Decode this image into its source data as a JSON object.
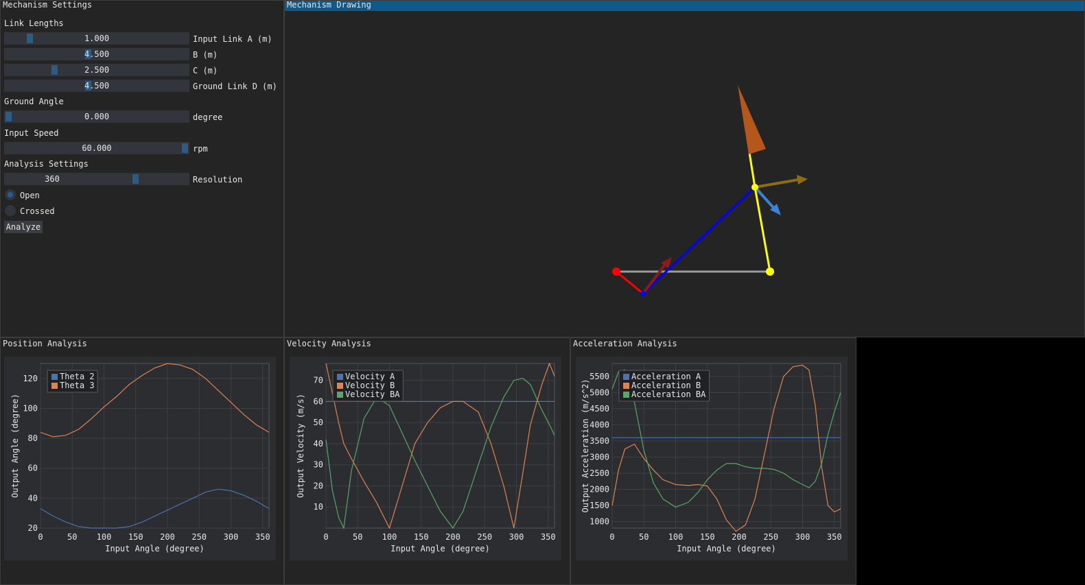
{
  "settings": {
    "title": "Mechanism Settings",
    "link_lengths_header": "Link Lengths",
    "sliders": [
      {
        "value": "1.000",
        "label": "Input Link A (m)",
        "fraction": 0.12
      },
      {
        "value": "4.500",
        "label": "B (m)",
        "fraction": 0.45
      },
      {
        "value": "2.500",
        "label": "C (m)",
        "fraction": 0.26
      },
      {
        "value": "4.500",
        "label": "Ground Link D (m)",
        "fraction": 0.45
      }
    ],
    "ground_angle_header": "Ground Angle",
    "ground_angle": {
      "value": "0.000",
      "label": "degree",
      "fraction": 0.0
    },
    "input_speed_header": "Input Speed",
    "input_speed": {
      "value": "60.000",
      "label": "rpm",
      "fraction": 1.0
    },
    "analysis_header": "Analysis Settings",
    "resolution": {
      "value": "360",
      "label": "Resolution",
      "fraction": 0.72
    },
    "radios": [
      {
        "label": "Open",
        "selected": true
      },
      {
        "label": "Crossed",
        "selected": false
      }
    ],
    "analyze_label": "Analyze",
    "accent_color": "#2a5c86"
  },
  "drawing": {
    "title": "Mechanism Drawing",
    "title_color": "#0f5a8a",
    "link_colors": {
      "input": "#ff0000",
      "coupler": "#0000ff",
      "output": "#ffff00",
      "ground": "#9b9b9b"
    }
  },
  "plots": {
    "position": {
      "title": "Position Analysis",
      "ylabel": "Output Angle (degree)",
      "xlabel": "Input Angle (degree)",
      "legend": [
        "Theta 2",
        "Theta 3"
      ]
    },
    "velocity": {
      "title": "Velocity Analysis",
      "ylabel": "Output Velocity (m/s)",
      "xlabel": "Input Angle (degree)",
      "legend": [
        "Velocity A",
        "Velocity B",
        "Velocity BA"
      ]
    },
    "acceleration": {
      "title": "Acceleration Analysis",
      "ylabel": "Output Acceleration (m/s^2)",
      "xlabel": "Input Angle (degree)",
      "legend": [
        "Acceleration A",
        "Acceleration B",
        "Acceleration BA"
      ]
    }
  },
  "chart_data": [
    {
      "type": "line",
      "xlim": [
        0,
        360
      ],
      "ylim": [
        20,
        130
      ],
      "xticks": [
        0,
        50,
        100,
        150,
        200,
        250,
        300,
        350
      ],
      "yticks": [
        20,
        40,
        60,
        80,
        100,
        120
      ],
      "grid": true,
      "legend_position": "top-left",
      "x": [
        0,
        20,
        40,
        60,
        80,
        100,
        120,
        140,
        160,
        180,
        200,
        220,
        240,
        260,
        280,
        300,
        320,
        340,
        360
      ],
      "series": [
        {
          "name": "Theta 2",
          "color": "#4c72b0",
          "values": [
            33,
            28,
            24,
            21,
            20,
            20,
            20,
            21,
            24,
            28,
            32,
            36,
            40,
            44,
            46,
            45,
            42,
            38,
            33
          ]
        },
        {
          "name": "Theta 3",
          "color": "#dd8452",
          "values": [
            84,
            81,
            82,
            86,
            93,
            101,
            108,
            116,
            122,
            127,
            130,
            129,
            126,
            120,
            112,
            104,
            96,
            89,
            84
          ]
        }
      ]
    },
    {
      "type": "line",
      "xlim": [
        0,
        360
      ],
      "ylim": [
        0,
        78
      ],
      "xticks": [
        0,
        50,
        100,
        150,
        200,
        250,
        300,
        350
      ],
      "yticks": [
        10,
        20,
        30,
        40,
        50,
        60,
        70
      ],
      "grid": true,
      "legend_position": "top-left",
      "x": [
        0,
        10,
        20,
        28,
        40,
        60,
        80,
        100,
        120,
        140,
        160,
        180,
        200,
        216,
        240,
        260,
        280,
        296,
        310,
        322,
        340,
        352,
        360
      ],
      "series": [
        {
          "name": "Velocity A",
          "color": "#4c72b0",
          "values": [
            60,
            60,
            60,
            60,
            60,
            60,
            60,
            60,
            60,
            60,
            60,
            60,
            60,
            60,
            60,
            60,
            60,
            60,
            60,
            60,
            60,
            60,
            60
          ]
        },
        {
          "name": "Velocity B",
          "color": "#dd8452",
          "values": [
            78,
            64,
            50,
            40,
            33,
            22,
            12,
            0,
            20,
            40,
            50,
            57,
            60,
            60,
            55,
            40,
            20,
            0,
            26,
            49,
            68,
            78,
            72
          ]
        },
        {
          "name": "Velocity BA",
          "color": "#55a868",
          "values": [
            42,
            18,
            5,
            0,
            27,
            52,
            62,
            58,
            45,
            32,
            20,
            8,
            0,
            8,
            30,
            48,
            62,
            70,
            71,
            68,
            56,
            49,
            44
          ]
        }
      ]
    },
    {
      "type": "line",
      "xlim": [
        0,
        360
      ],
      "ylim": [
        800,
        5900
      ],
      "xticks": [
        0,
        50,
        100,
        150,
        200,
        250,
        300,
        350
      ],
      "yticks": [
        1000,
        1500,
        2000,
        2500,
        3000,
        3500,
        4000,
        4500,
        5000,
        5500
      ],
      "grid": true,
      "legend_position": "top-left",
      "x": [
        0,
        10,
        20,
        35,
        50,
        65,
        80,
        100,
        120,
        135,
        150,
        165,
        180,
        195,
        210,
        225,
        240,
        255,
        270,
        285,
        300,
        310,
        320,
        330,
        340,
        350,
        360
      ],
      "series": [
        {
          "name": "Acceleration A",
          "color": "#4c72b0",
          "values": [
            3600,
            3600,
            3600,
            3600,
            3600,
            3600,
            3600,
            3600,
            3600,
            3600,
            3600,
            3600,
            3600,
            3600,
            3600,
            3600,
            3600,
            3600,
            3600,
            3600,
            3600,
            3600,
            3600,
            3600,
            3600,
            3600,
            3600
          ]
        },
        {
          "name": "Acceleration B",
          "color": "#dd8452",
          "values": [
            1500,
            2600,
            3250,
            3400,
            2950,
            2600,
            2300,
            2150,
            2120,
            2150,
            2100,
            1700,
            1050,
            700,
            900,
            1700,
            3100,
            4500,
            5500,
            5800,
            5850,
            5700,
            4600,
            2700,
            1500,
            1300,
            1400
          ]
        },
        {
          "name": "Acceleration BA",
          "color": "#55a868",
          "values": [
            5100,
            5650,
            5700,
            4700,
            3200,
            2200,
            1700,
            1450,
            1600,
            1900,
            2300,
            2600,
            2800,
            2800,
            2700,
            2650,
            2650,
            2620,
            2500,
            2300,
            2150,
            2050,
            2250,
            2800,
            3700,
            4400,
            5000
          ]
        }
      ]
    }
  ]
}
